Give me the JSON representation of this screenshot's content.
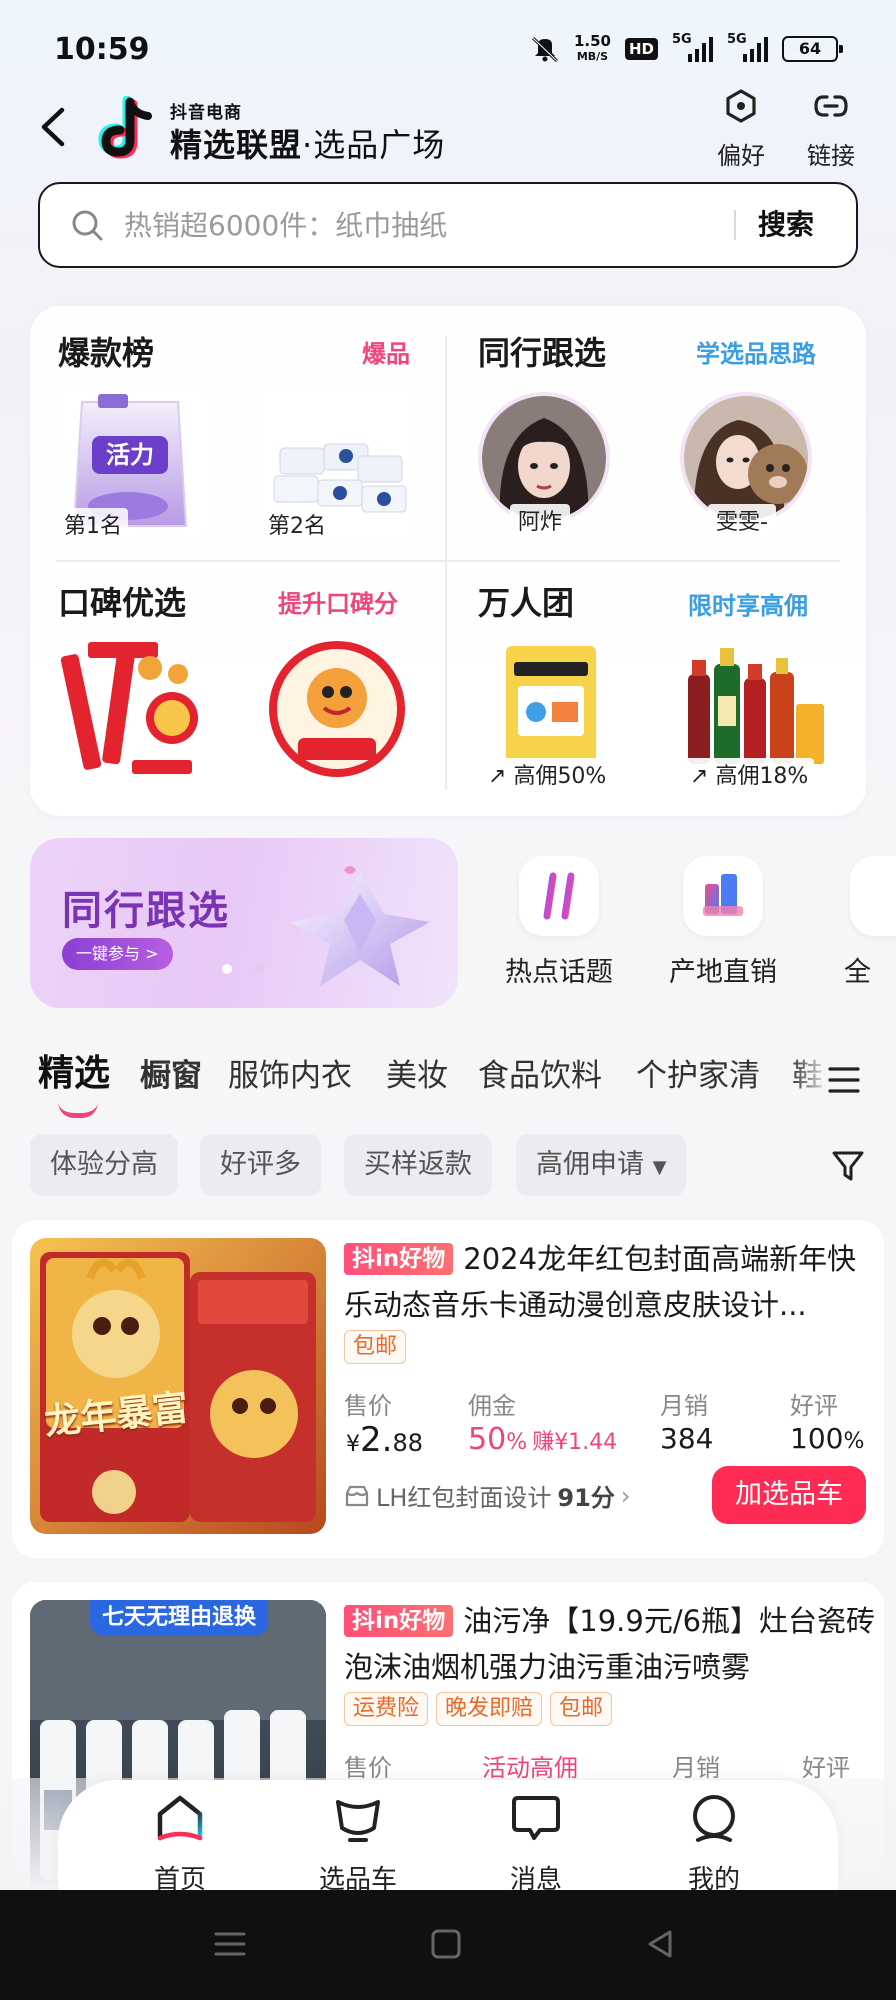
{
  "status_bar": {
    "time": "10:59",
    "net_speed": "1.50",
    "net_unit": "MB/S",
    "hd": "HD",
    "sig1": "5G",
    "sig2": "5G",
    "battery": "64"
  },
  "header": {
    "brand_small": "抖音电商",
    "brand_title": "精选联盟",
    "brand_sep": "·",
    "brand_subtitle": "选品广场",
    "pref_label": "偏好",
    "link_label": "链接"
  },
  "search": {
    "placeholder": "热销超6000件：纸巾抽纸",
    "button": "搜索"
  },
  "feature_card": {
    "hot_list": {
      "title": "爆款榜",
      "link": "爆品",
      "items": [
        "第1名",
        "第2名"
      ]
    },
    "peer_follow": {
      "title": "同行跟选",
      "link": "学选品思路",
      "users": [
        "阿炸",
        "雯雯-"
      ]
    },
    "reputation": {
      "title": "口碑优选",
      "link": "提升口碑分"
    },
    "group_buy": {
      "title": "万人团",
      "link": "限时享高佣",
      "items": [
        "高佣50%",
        "高佣18%"
      ]
    }
  },
  "banner": {
    "title": "同行跟选",
    "cta": "一键参与 >"
  },
  "quick_nav": [
    {
      "label": "热点话题",
      "icon": "hashtag-icon"
    },
    {
      "label": "产地直销",
      "icon": "origin-icon"
    },
    {
      "label": "全",
      "icon": "all-icon"
    }
  ],
  "tabs": [
    "精选",
    "橱窗",
    "服饰内衣",
    "美妆",
    "食品饮料",
    "个护家清",
    "鞋"
  ],
  "filters": [
    "体验分高",
    "好评多",
    "买样返款",
    "高佣申请"
  ],
  "products": [
    {
      "badge": "抖in好物",
      "title": "2024龙年红包封面高端新年快乐动态音乐卡通动漫创意皮肤设计...",
      "tags": [
        "包邮"
      ],
      "price_label": "售价",
      "price_symbol": "¥",
      "price_int": "2.",
      "price_dec": "88",
      "commission_label": "佣金",
      "commission_rate": "50",
      "commission_pct": "%",
      "commission_earn": "赚¥1.44",
      "sales_label": "月销",
      "sales": "384",
      "rating_label": "好评",
      "rating": "100",
      "rating_pct": "%",
      "shop": "LH红包封面设计",
      "shop_score": "91分",
      "cart_button": "加选品车",
      "img_text": "龙年暴富"
    },
    {
      "badge": "抖in好物",
      "title": "油污净【19.9元/6瓶】灶台瓷砖泡沫油烟机强力油污重油污喷雾",
      "tags": [
        "运费险",
        "晚发即赔",
        "包邮"
      ],
      "price_label": "售价",
      "commission_label": "活动高佣",
      "sales_label": "月销",
      "rating_label": "好评",
      "img_banner": "七天无理由退换"
    }
  ],
  "bottom_nav": [
    "首页",
    "选品车",
    "消息",
    "我的"
  ],
  "colors": {
    "accent": "#fe2c55",
    "pink": "#f0457a",
    "blue": "#3a9ee4",
    "purple": "#7a33b3"
  }
}
